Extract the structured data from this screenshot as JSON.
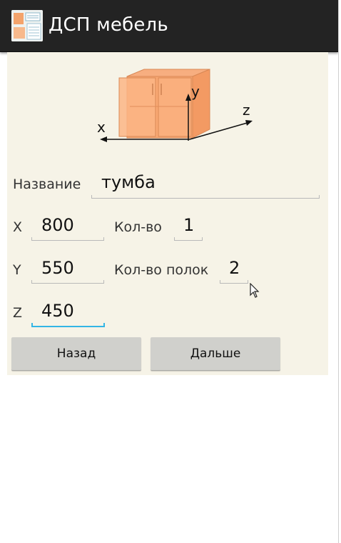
{
  "app": {
    "title": "ДСП мебель",
    "icon": "app-furniture-icon"
  },
  "diagram": {
    "axis_x": "x",
    "axis_y": "y",
    "axis_z": "z",
    "cabinet_color": "#f7a46e"
  },
  "form": {
    "name_label": "Название",
    "name_value": "тумба",
    "x_label": "X",
    "x_value": "800",
    "y_label": "Y",
    "y_value": "550",
    "z_label": "Z",
    "z_value": "450",
    "count_label": "Кол-во",
    "count_value": "1",
    "shelves_label": "Кол-во полок",
    "shelves_value": "2"
  },
  "buttons": {
    "back_label": "Назад",
    "next_label": "Дальше"
  },
  "colors": {
    "actionbar": "#232323",
    "content_bg": "#f6f3e7",
    "focus_accent": "#33b5e5",
    "button_bg": "#d0d0cc"
  }
}
